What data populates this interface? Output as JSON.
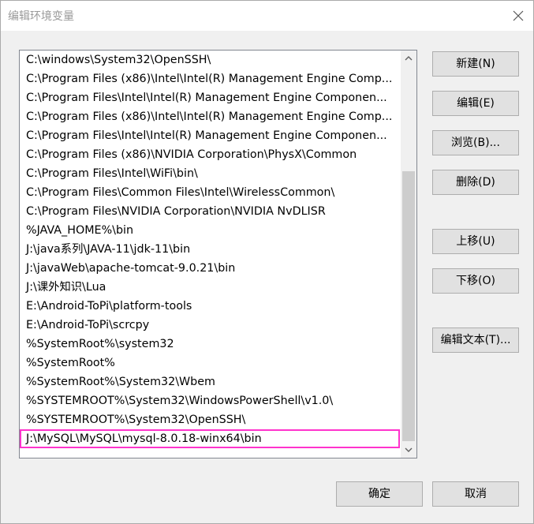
{
  "window": {
    "title": "编辑环境变量"
  },
  "icons": {
    "close": "close-icon",
    "scroll_up": "chevron-up-icon",
    "scroll_down": "chevron-down-icon"
  },
  "list": {
    "items": [
      "C:\\windows\\System32\\OpenSSH\\",
      "C:\\Program Files (x86)\\Intel\\Intel(R) Management Engine Comp...",
      "C:\\Program Files\\Intel\\Intel(R) Management Engine Componen...",
      "C:\\Program Files (x86)\\Intel\\Intel(R) Management Engine Comp...",
      "C:\\Program Files\\Intel\\Intel(R) Management Engine Componen...",
      "C:\\Program Files (x86)\\NVIDIA Corporation\\PhysX\\Common",
      "C:\\Program Files\\Intel\\WiFi\\bin\\",
      "C:\\Program Files\\Common Files\\Intel\\WirelessCommon\\",
      "C:\\Program Files\\NVIDIA Corporation\\NVIDIA NvDLISR",
      "%JAVA_HOME%\\bin",
      "J:\\java系列\\JAVA-11\\jdk-11\\bin",
      "J:\\javaWeb\\apache-tomcat-9.0.21\\bin",
      "J:\\课外知识\\Lua",
      "E:\\Android-ToPi\\platform-tools",
      "E:\\Android-ToPi\\scrcpy",
      "%SystemRoot%\\system32",
      "%SystemRoot%",
      "%SystemRoot%\\System32\\Wbem",
      "%SYSTEMROOT%\\System32\\WindowsPowerShell\\v1.0\\",
      "%SYSTEMROOT%\\System32\\OpenSSH\\",
      "J:\\MySQL\\MySQL\\mysql-8.0.18-winx64\\bin"
    ],
    "selected_index": 20,
    "highlight_color": "#ff33cc"
  },
  "buttons": {
    "new": "新建(N)",
    "edit": "编辑(E)",
    "browse": "浏览(B)...",
    "delete": "删除(D)",
    "move_up": "上移(U)",
    "move_down": "下移(O)",
    "edit_text": "编辑文本(T)...",
    "ok": "确定",
    "cancel": "取消"
  }
}
